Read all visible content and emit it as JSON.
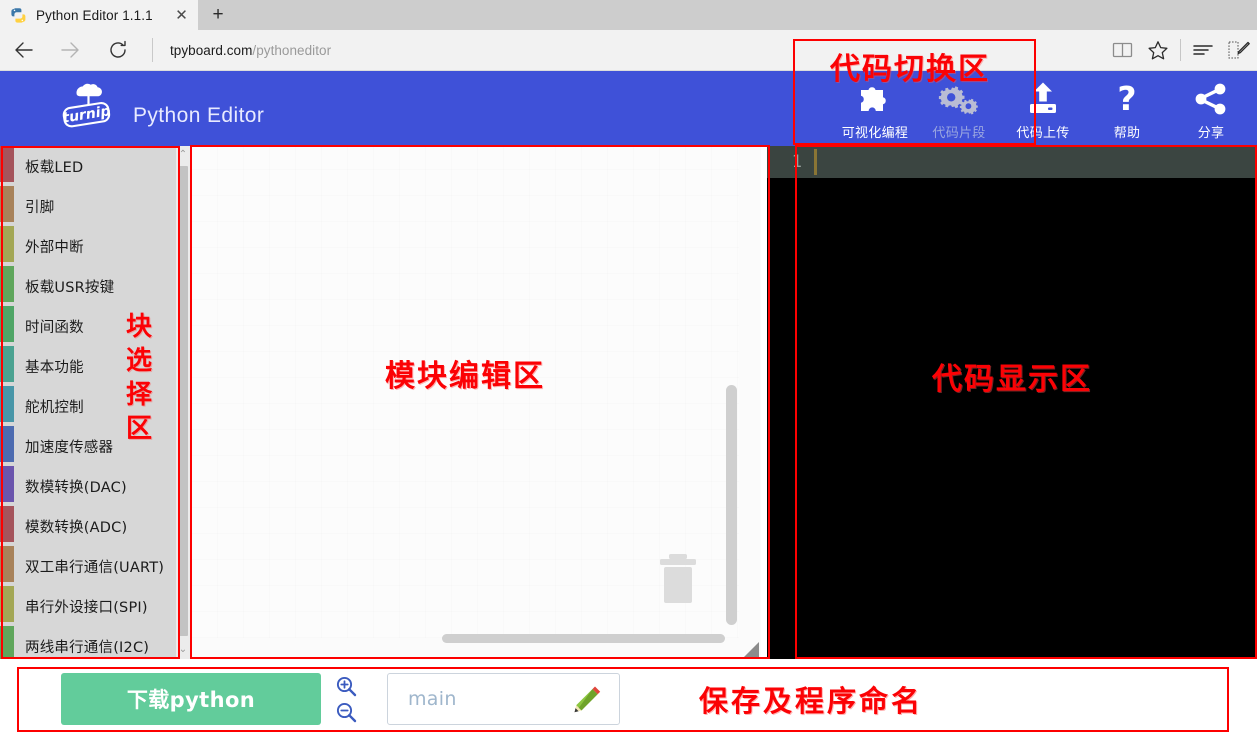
{
  "browser": {
    "tab": {
      "title": "Python Editor 1.1.1",
      "favicon": "python-logo-icon",
      "close": "✕"
    },
    "newtab_label": "+",
    "nav": {
      "back": "←",
      "forward": "→",
      "reload": "↻"
    },
    "url": {
      "host": "tpyboard.com",
      "path": "/pythoneditor"
    },
    "toolbar_icons": [
      "reading-view-icon",
      "favorites-star-icon",
      "hub-icon",
      "notes-icon"
    ]
  },
  "header": {
    "brand_name": "Python Editor",
    "logo": "turnip-cloud-logo",
    "actions": [
      {
        "label": "可视化编程",
        "icon": "puzzle-piece-icon",
        "disabled": false
      },
      {
        "label": "代码片段",
        "icon": "gears-icon",
        "disabled": true
      },
      {
        "label": "代码上传",
        "icon": "upload-icon",
        "disabled": false
      },
      {
        "label": "帮助",
        "icon": "question-mark-icon",
        "disabled": false
      },
      {
        "label": "分享",
        "icon": "share-icon",
        "disabled": false
      }
    ]
  },
  "toolbox": {
    "items": [
      {
        "label": "板载LED",
        "color": "#a5545c"
      },
      {
        "label": "引脚",
        "color": "#a8825a"
      },
      {
        "label": "外部中断",
        "color": "#a3a755"
      },
      {
        "label": "板载USR按键",
        "color": "#5fa65c"
      },
      {
        "label": "时间函数",
        "color": "#4fa566"
      },
      {
        "label": "基本功能",
        "color": "#4ba291"
      },
      {
        "label": "舵机控制",
        "color": "#4896a8"
      },
      {
        "label": "加速度传感器",
        "color": "#4d6bb0"
      },
      {
        "label": "数模转换(DAC)",
        "color": "#6b55ad"
      },
      {
        "label": "模数转换(ADC)",
        "color": "#a5545c"
      },
      {
        "label": "双工串行通信(UART)",
        "color": "#a8825a"
      },
      {
        "label": "串行外设接口(SPI)",
        "color": "#a3a755"
      },
      {
        "label": "两线串行通信(I2C)",
        "color": "#5fa65c"
      }
    ],
    "scroll_up": "⌃",
    "scroll_down": "⌄"
  },
  "canvas": {
    "annotation": "模块编辑区",
    "trash_icon": "trash-can-icon",
    "resize_icon": "resize-grip-icon"
  },
  "code_panel": {
    "line_number": "1",
    "code_text": "",
    "annotation": "代码显示区"
  },
  "bottom": {
    "download_label": "下载python",
    "zoom_in_icon": "zoom-in-icon",
    "zoom_out_icon": "zoom-out-icon",
    "name_value": "main",
    "pencil_icon": "pencil-edit-icon",
    "annotation": "保存及程序命名"
  },
  "annotations": {
    "code_switch": "代码切换区",
    "toolbox_region": "块选择区"
  },
  "colors": {
    "header_blue": "#3f51d8",
    "annotation_red": "#fb0205",
    "download_green": "#62cc9b",
    "toolbox_gray": "#d7d7d7",
    "code_black": "#000000",
    "code_activeline": "#3b4541"
  }
}
